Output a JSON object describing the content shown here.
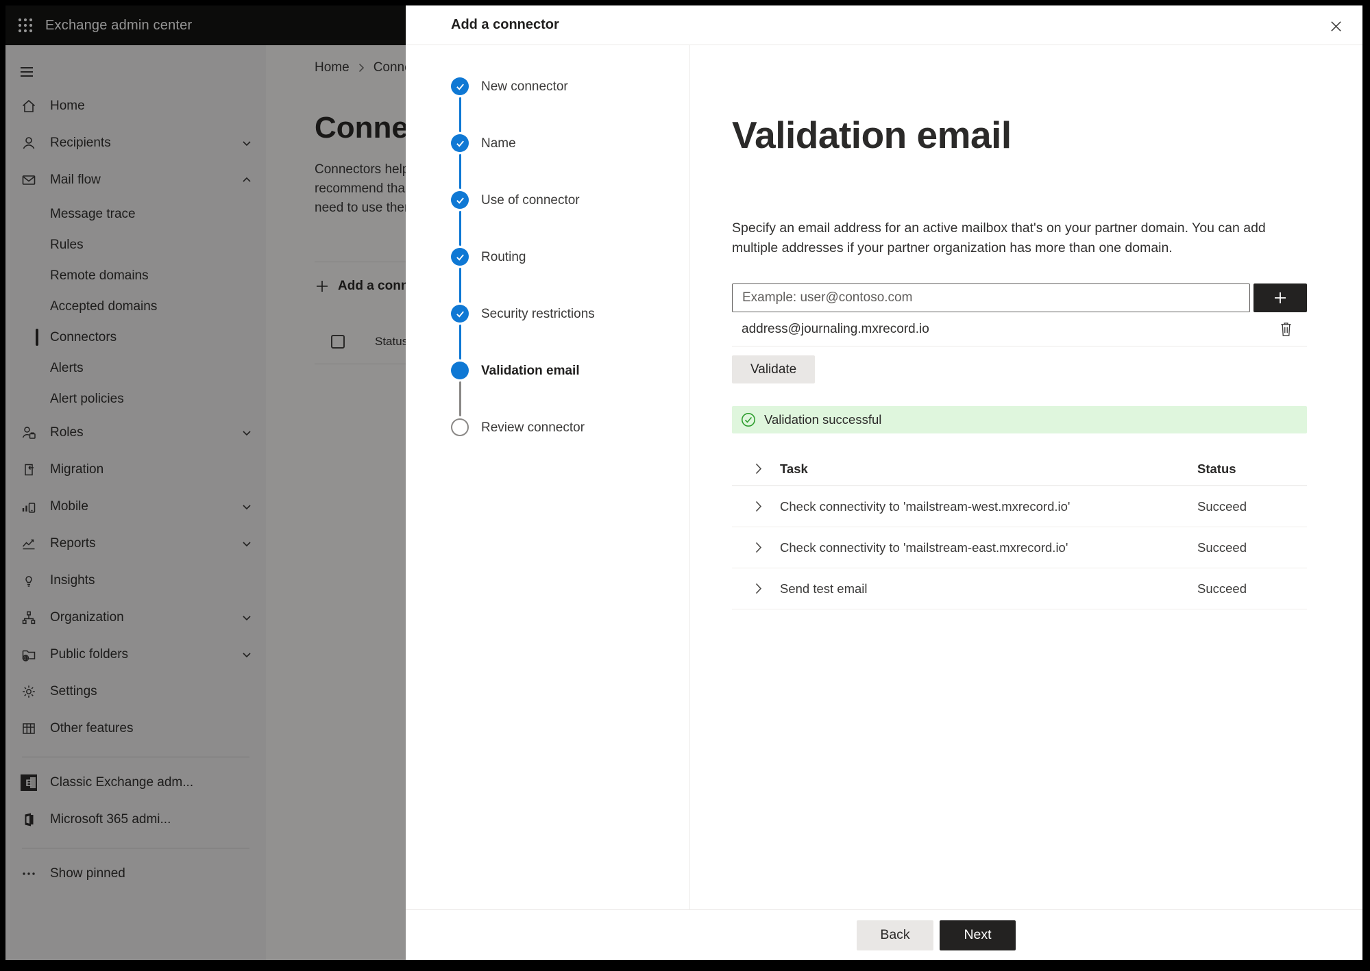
{
  "topbar": {
    "title": "Exchange admin center"
  },
  "sidebar": {
    "items": [
      {
        "label": "Home"
      },
      {
        "label": "Recipients"
      },
      {
        "label": "Mail flow"
      },
      {
        "label": "Message trace"
      },
      {
        "label": "Rules"
      },
      {
        "label": "Remote domains"
      },
      {
        "label": "Accepted domains"
      },
      {
        "label": "Connectors"
      },
      {
        "label": "Alerts"
      },
      {
        "label": "Alert policies"
      },
      {
        "label": "Roles"
      },
      {
        "label": "Migration"
      },
      {
        "label": "Mobile"
      },
      {
        "label": "Reports"
      },
      {
        "label": "Insights"
      },
      {
        "label": "Organization"
      },
      {
        "label": "Public folders"
      },
      {
        "label": "Settings"
      },
      {
        "label": "Other features"
      },
      {
        "label": "Classic Exchange adm..."
      },
      {
        "label": "Microsoft 365 admi..."
      },
      {
        "label": "Show pinned"
      }
    ]
  },
  "background": {
    "breadcrumb": {
      "home": "Home",
      "current": "Conne"
    },
    "heading": "Connectors",
    "para_lines": [
      "Connectors help",
      "recommend tha",
      "need to use ther"
    ],
    "add_button": "Add a conn",
    "status_header": "Status"
  },
  "panel": {
    "title_bar": "Add a connector",
    "steps": [
      {
        "label": "New connector",
        "state": "done"
      },
      {
        "label": "Name",
        "state": "done"
      },
      {
        "label": "Use of connector",
        "state": "done"
      },
      {
        "label": "Routing",
        "state": "done"
      },
      {
        "label": "Security restrictions",
        "state": "done"
      },
      {
        "label": "Validation email",
        "state": "active"
      },
      {
        "label": "Review connector",
        "state": "upcoming"
      }
    ],
    "heading": "Validation email",
    "description_lines": [
      "Specify an email address for an active mailbox that's on your partner domain. You can add",
      "multiple addresses if your partner organization has more than one domain."
    ],
    "email_input_placeholder": "Example: user@contoso.com",
    "added_address": "address@journaling.mxrecord.io",
    "validate_button": "Validate",
    "success_message": "Validation successful",
    "table": {
      "headers": {
        "task": "Task",
        "status": "Status"
      },
      "rows": [
        {
          "task": "Check connectivity to 'mailstream-west.mxrecord.io'",
          "status": "Succeed"
        },
        {
          "task": "Check connectivity to 'mailstream-east.mxrecord.io'",
          "status": "Succeed"
        },
        {
          "task": "Send test email",
          "status": "Succeed"
        }
      ]
    },
    "back_button": "Back",
    "next_button": "Next"
  },
  "colors": {
    "accent_blue": "#0f78d4",
    "success_green": "#2f9e2f",
    "success_bg": "#dff6dd",
    "dark_button": "#232221"
  }
}
